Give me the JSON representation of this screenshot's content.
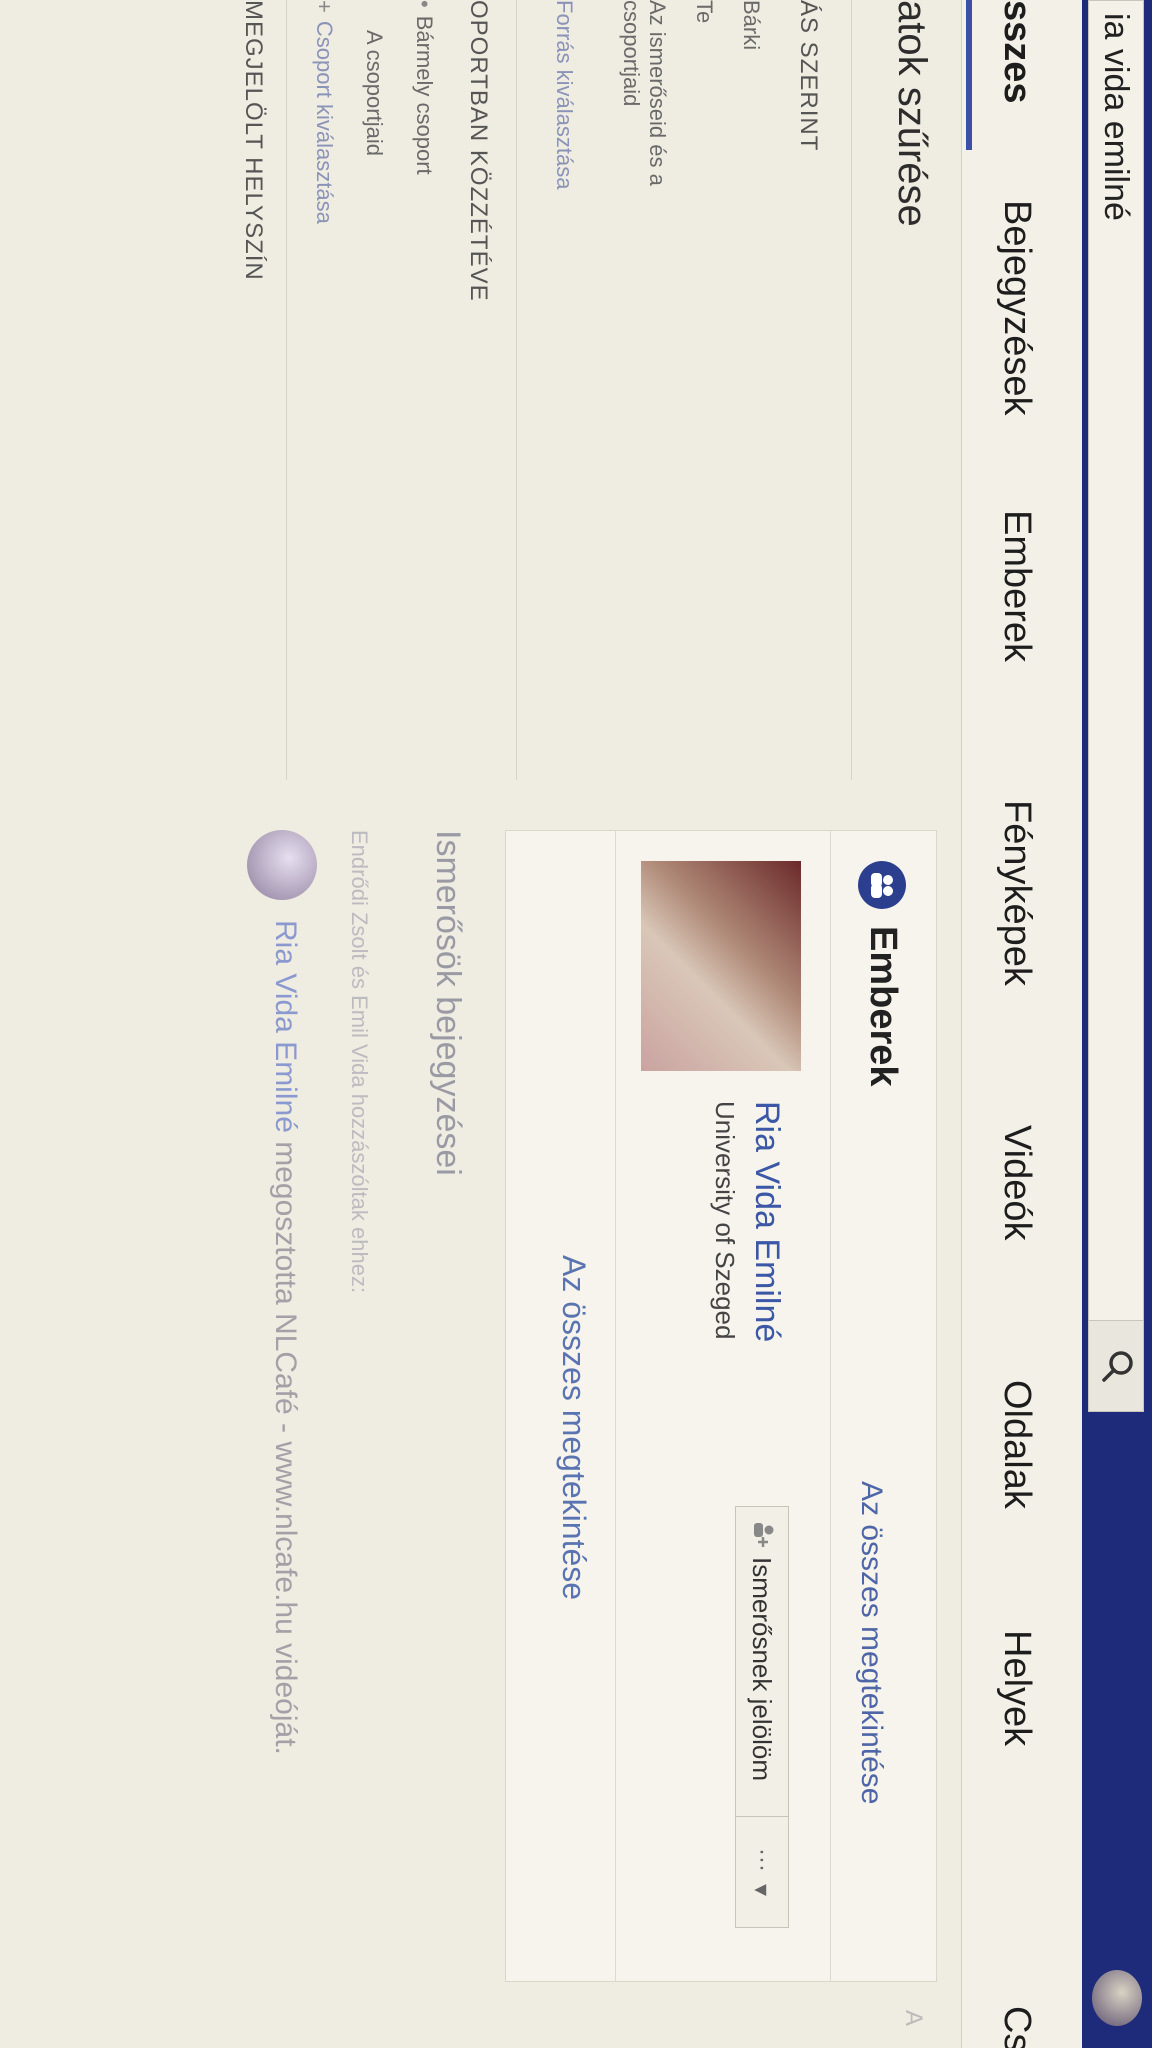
{
  "search": {
    "query": "ia vida emilné"
  },
  "tabs": [
    {
      "label": "sszes"
    },
    {
      "label": "Bejegyzések"
    },
    {
      "label": "Emberek"
    },
    {
      "label": "Fényképek"
    },
    {
      "label": "Videók"
    },
    {
      "label": "Oldalak"
    },
    {
      "label": "Helyek"
    },
    {
      "label": "Cs"
    }
  ],
  "filters": {
    "title": "atok szűrése",
    "by_source": {
      "heading": "ÁS SZERINT",
      "items": [
        "Bárki",
        "Te",
        "Az ismerőseid és a csoportjaid"
      ],
      "link": "Forrás kiválasztása"
    },
    "by_group": {
      "heading": "OPORTBAN KÖZZÉTÉVE",
      "items": [
        "Bármely csoport",
        "A csoportjaid"
      ],
      "link": "Csoport kiválasztása"
    },
    "by_location": {
      "heading": "MEGJELÖLT HELYSZÍN"
    }
  },
  "people_panel": {
    "title": "Emberek",
    "see_all_top": "Az összes megtekintése",
    "person": {
      "name": "Ria Vida Emilné",
      "subtitle": "University of Szeged",
      "add_friend": "Ismerősnek jelölöm",
      "more": "···"
    },
    "see_all_bottom": "Az összes megtekintése"
  },
  "friend_posts": {
    "title": "Ismerősök bejegyzései",
    "caption": "Endrődi Zsolt és Emil Vida hozzászóltak ehhez:",
    "post_author": "Ria Vida Emilné",
    "post_text": " megosztotta NLCafé - www.nlcafe.hu videóját."
  },
  "colors": {
    "topbar": "#1e2a7a",
    "link": "#3b57a6",
    "panel_bg": "#f6f4ec"
  }
}
